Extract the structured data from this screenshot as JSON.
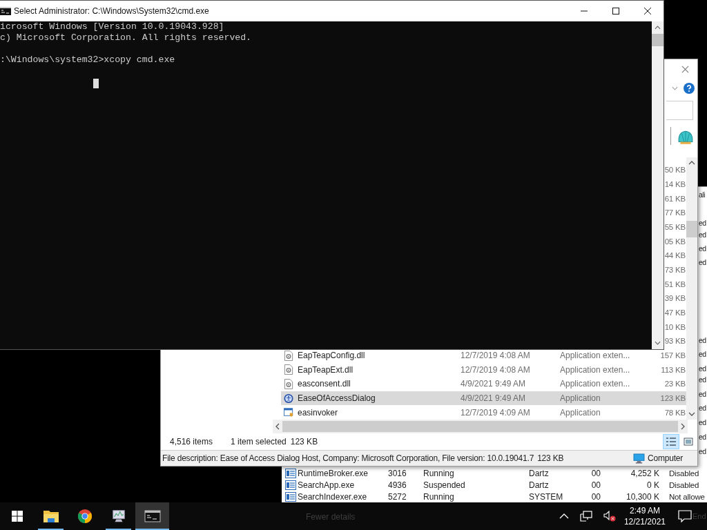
{
  "cmd_window": {
    "title": "Select Administrator: C:\\Windows\\System32\\cmd.exe",
    "blocks": [
      {
        "lines": [
          "icrosoft Windows [Version 10.0.19043.928]",
          "c) Microsoft Corporation. All rights reserved."
        ]
      },
      {
        "lines": [
          ":\\Windows\\system32>xcopy cmd.exe"
        ]
      }
    ]
  },
  "explorer_window": {
    "rows": [
      {
        "size": "50 KB",
        "selected": false
      },
      {
        "size": "14 KB",
        "selected": false
      },
      {
        "size": "61 KB",
        "selected": false
      },
      {
        "size": "77 KB",
        "selected": false
      },
      {
        "size": "55 KB",
        "selected": false
      },
      {
        "size": "05 KB",
        "selected": false
      },
      {
        "size": "44 KB",
        "selected": false
      },
      {
        "size": "73 KB",
        "selected": false
      },
      {
        "size": "51 KB",
        "selected": false
      },
      {
        "size": "39 KB",
        "selected": false
      },
      {
        "size": "47 KB",
        "selected": false
      },
      {
        "size": "10 KB",
        "selected": false
      },
      {
        "size": "93 KB",
        "selected": false
      },
      {
        "kind": "dll",
        "name": "EapTeapConfig.dll",
        "date": "12/7/2019 4:08 AM",
        "type": "Application exten...",
        "size": "157 KB",
        "selected": false
      },
      {
        "kind": "dll",
        "name": "EapTeapExt.dll",
        "date": "12/7/2019 4:08 AM",
        "type": "Application exten...",
        "size": "113 KB",
        "selected": false
      },
      {
        "kind": "dll",
        "name": "easconsent.dll",
        "date": "4/9/2021 9:49 AM",
        "type": "Application exten...",
        "size": "23 KB",
        "selected": false
      },
      {
        "kind": "access",
        "name": "EaseOfAccessDialog",
        "date": "4/9/2021 9:49 AM",
        "type": "Application",
        "size": "123 KB",
        "selected": true
      },
      {
        "kind": "app",
        "name": "easinvoker",
        "date": "12/7/2019 4:09 AM",
        "type": "Application",
        "size": "78 KB",
        "selected": false
      }
    ],
    "status": {
      "item_count": "4,516 items",
      "selection": "1 item selected",
      "selection_size": "123 KB"
    },
    "details": {
      "description": "File description: Ease of Access Dialog Host, Company: Microsoft Corporation, File version: 10.0.19041.7",
      "size": "123 KB",
      "location": "Computer"
    }
  },
  "task_manager": {
    "edge_fragments": [
      "ali",
      "ed",
      "ed",
      "ed",
      "ed",
      "ed",
      "ed",
      "ed",
      "ed",
      "ed",
      "ed",
      "ed",
      "ed",
      "ed"
    ],
    "rows": [
      {
        "name": "RuntimeBroker.exe",
        "pid": "3016",
        "status": "Running",
        "user": "Dartz",
        "cpu": "00",
        "memory": "4,252 K",
        "uac": "Disabled"
      },
      {
        "name": "SearchApp.exe",
        "pid": "4936",
        "status": "Suspended",
        "user": "Dartz",
        "cpu": "00",
        "memory": "0 K",
        "uac": "Disabled"
      },
      {
        "name": "SearchIndexer.exe",
        "pid": "5272",
        "status": "Running",
        "user": "SYSTEM",
        "cpu": "00",
        "memory": "10,300 K",
        "uac": "Not allowe"
      }
    ],
    "footer_link": "Fewer details",
    "footer_button": "End"
  },
  "taskbar": {
    "apps": [
      {
        "kind": "folder",
        "running": true,
        "active": false
      },
      {
        "kind": "browser",
        "running": false,
        "active": false
      },
      {
        "kind": "monitor",
        "running": true,
        "active": false
      },
      {
        "kind": "console",
        "running": true,
        "active": true
      }
    ],
    "volume_muted": true,
    "time": "2:49 AM",
    "date": "12/21/2021"
  }
}
